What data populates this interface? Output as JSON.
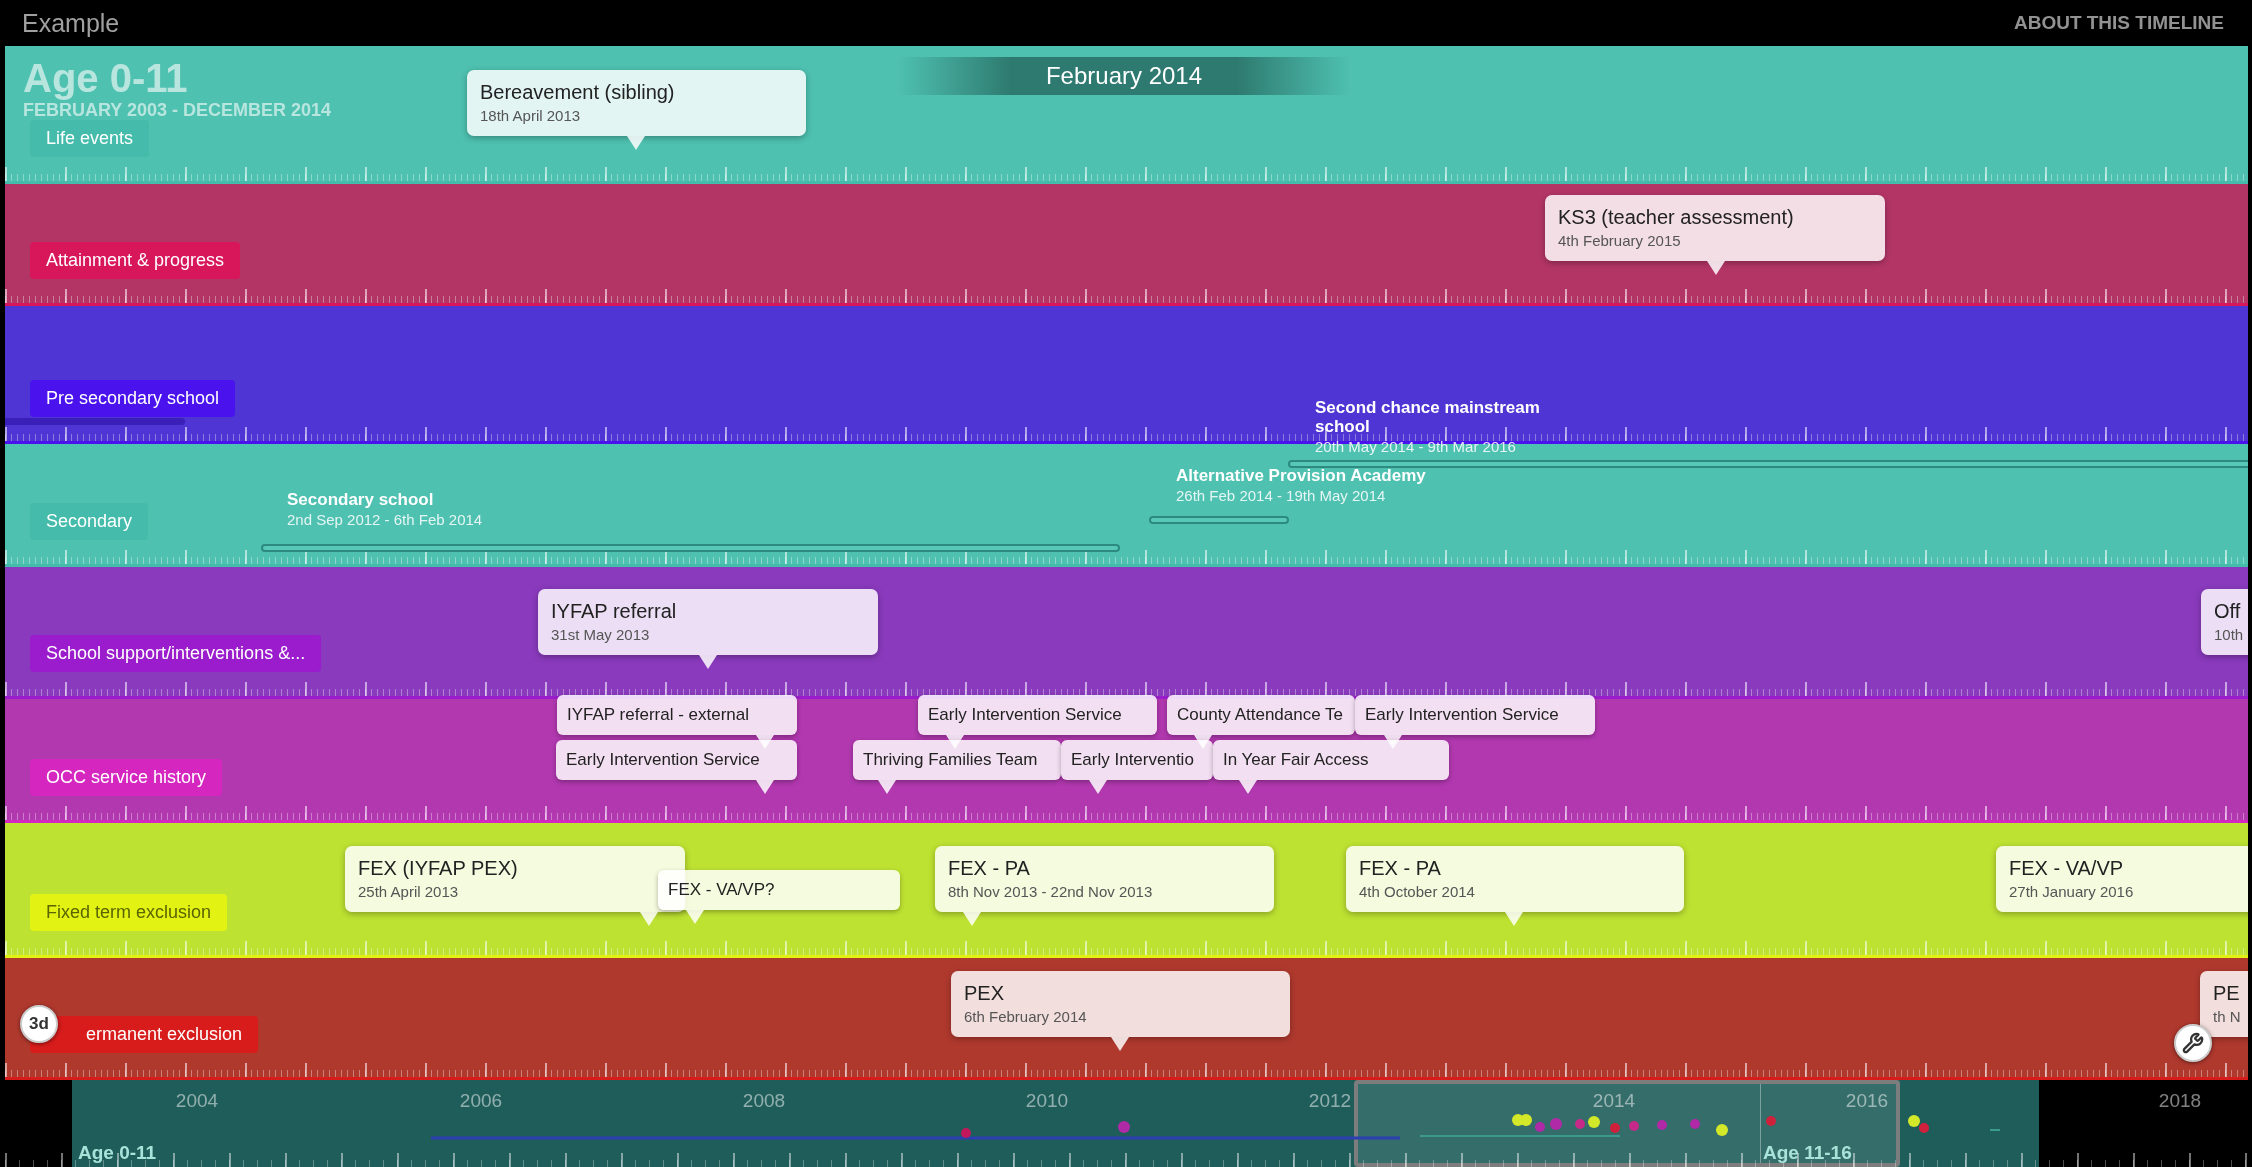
{
  "app": {
    "title": "Example",
    "about_link": "ABOUT THIS TIMELINE"
  },
  "header": {
    "title": "Age 0-11",
    "range": "FEBRUARY 2003 - DECEMBER 2014",
    "current_date": "February 2014"
  },
  "bands": [
    {
      "label": "Life events",
      "color": "#4ec1b0",
      "events": [
        {
          "kind": "callout",
          "title": "Bereavement (sibling)",
          "date": "18th April 2013"
        }
      ]
    },
    {
      "label": "Attainment & progress",
      "color": "#b33566",
      "events": [
        {
          "kind": "callout",
          "title": "KS3 (teacher assessment)",
          "date": "4th February 2015"
        }
      ]
    },
    {
      "label": "Pre secondary school",
      "color": "#4f35d4",
      "events": [
        {
          "kind": "bar"
        }
      ]
    },
    {
      "label": "Secondary",
      "color": "#4ec1b0",
      "events": [
        {
          "kind": "span",
          "title": "Secondary school",
          "date": "2nd Sep 2012 - 6th Feb 2014"
        },
        {
          "kind": "span",
          "title": "Alternative Provision Academy",
          "date": "26th Feb 2014 - 19th May 2014"
        },
        {
          "kind": "span",
          "title": "Second chance mainstream school",
          "date": "20th May 2014 - 9th Mar 2016"
        }
      ]
    },
    {
      "label": "School support/interventions &...",
      "color": "#8a3abd",
      "events": [
        {
          "kind": "callout",
          "title": "IYFAP referral",
          "date": "31st May 2013"
        },
        {
          "kind": "callout",
          "title": "Off",
          "date": "10th"
        }
      ]
    },
    {
      "label": "OCC service history",
      "color": "#b238b0",
      "events": [
        {
          "kind": "tag",
          "title": "IYFAP referral - external"
        },
        {
          "kind": "tag",
          "title": "Early Intervention Service"
        },
        {
          "kind": "tag",
          "title": "County Attendance Te"
        },
        {
          "kind": "tag",
          "title": "Early Intervention Service"
        },
        {
          "kind": "tag",
          "title": "Early Intervention Service"
        },
        {
          "kind": "tag",
          "title": "Thriving Families Team"
        },
        {
          "kind": "tag",
          "title": "Early Interventio"
        },
        {
          "kind": "tag",
          "title": "In Year Fair Access"
        }
      ]
    },
    {
      "label": "Fixed term exclusion",
      "color": "#bee232",
      "events": [
        {
          "kind": "callout",
          "title": "FEX (IYFAP PEX)",
          "date": "25th April 2013"
        },
        {
          "kind": "tag",
          "title": "FEX - VA/VP?"
        },
        {
          "kind": "callout",
          "title": "FEX - PA",
          "date": "8th Nov 2013 - 22nd Nov 2013"
        },
        {
          "kind": "callout",
          "title": "FEX - PA",
          "date": "4th October 2014"
        },
        {
          "kind": "callout",
          "title": "FEX - VA/VP",
          "date": "27th January 2016"
        }
      ]
    },
    {
      "label": "ermanent exclusion",
      "color": "#b0392e",
      "events": [
        {
          "kind": "callout",
          "title": "PEX",
          "date": "6th February 2014"
        },
        {
          "kind": "callout",
          "title": "PE",
          "date": "th N"
        }
      ]
    }
  ],
  "controls": {
    "view_toggle": "3d"
  },
  "navigator": {
    "years": [
      "2004",
      "2006",
      "2008",
      "2010",
      "2012",
      "2014",
      "2016",
      "2018"
    ],
    "periods": [
      {
        "label": "Age 0-11"
      },
      {
        "label": "Age 11-16"
      }
    ]
  }
}
